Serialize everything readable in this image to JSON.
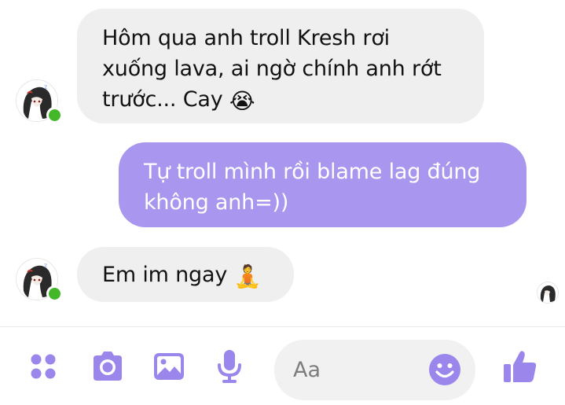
{
  "theme": {
    "accent": "#9b86ec",
    "incoming_bubble": "#efefef",
    "outgoing_bubble": "#a996ee",
    "online": "#42b72a"
  },
  "messages": [
    {
      "sender": "them",
      "lines": [
        "Hôm qua anh troll Kresh rơi",
        "xuống lava, ai ngờ chính anh rớt",
        "trước... Cay"
      ],
      "emoji": "😭",
      "emoji_name": "loudly-crying-face"
    },
    {
      "sender": "me",
      "lines": [
        "Tự troll mình rồi blame lag đúng",
        "không anh=))"
      ]
    },
    {
      "sender": "them",
      "lines": [
        "Em im ngay"
      ],
      "emoji": "🧘",
      "emoji_name": "person-in-lotus-position"
    }
  ],
  "composer": {
    "placeholder": "Aa",
    "icons": [
      "menu-dots-icon",
      "camera-icon",
      "image-icon",
      "microphone-icon",
      "emoji-icon",
      "thumbs-up-icon"
    ]
  }
}
